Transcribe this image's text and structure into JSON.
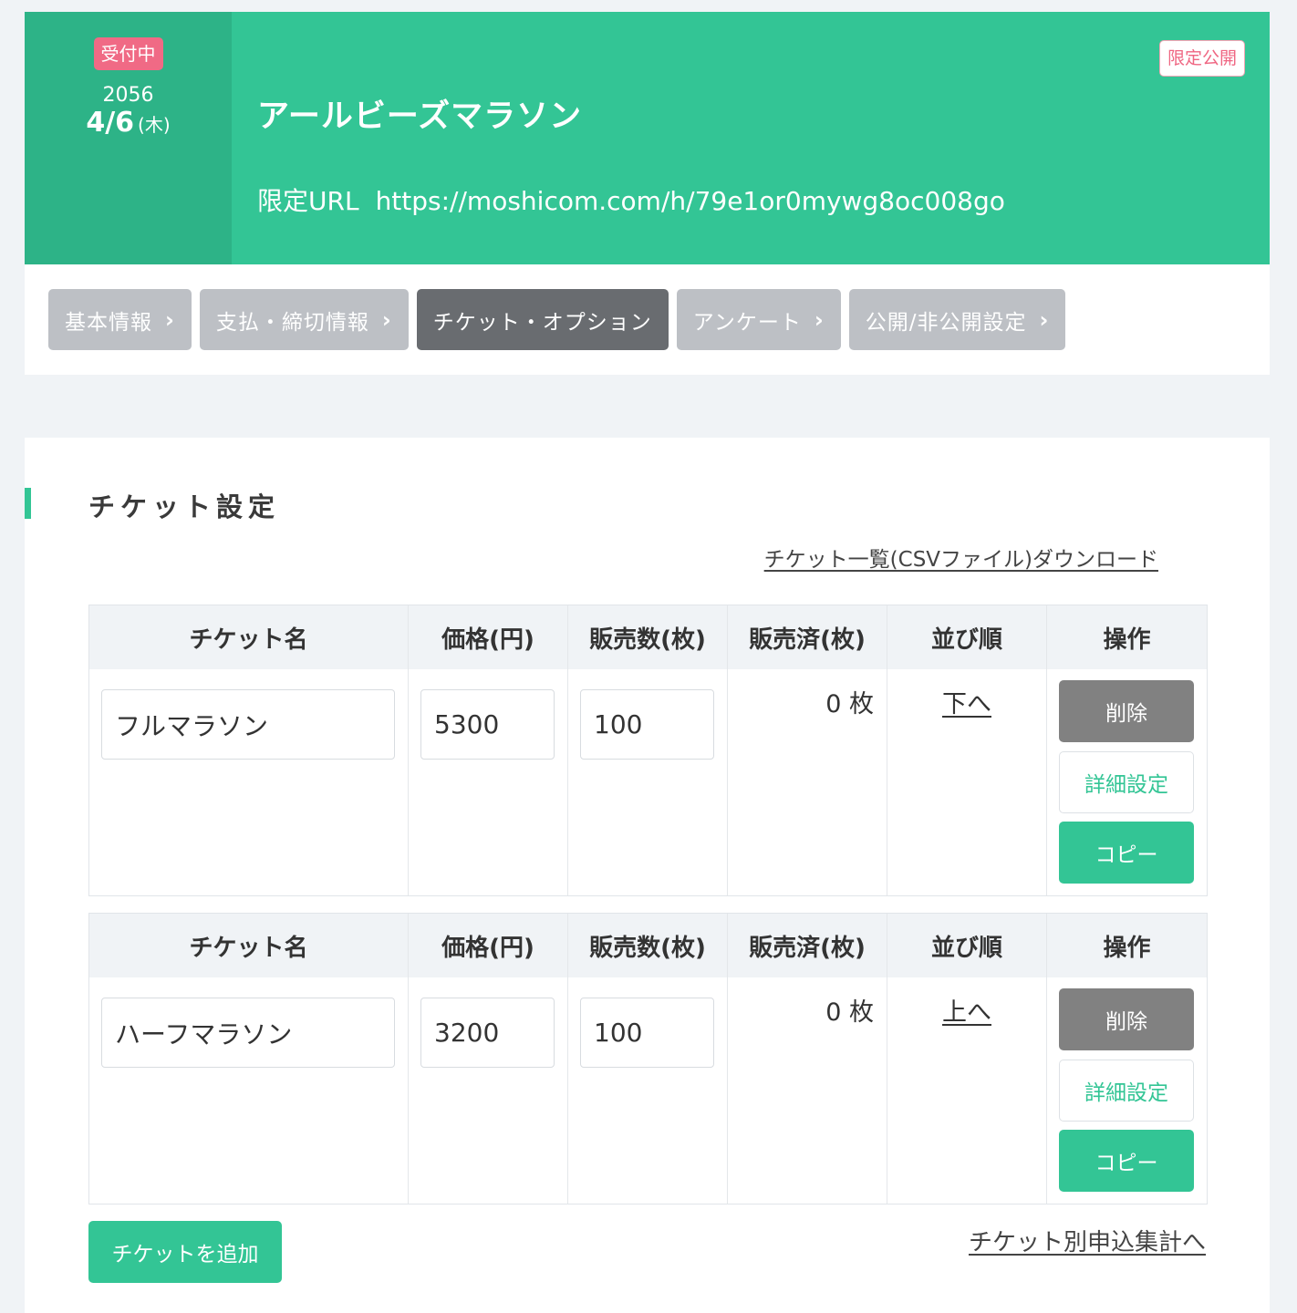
{
  "event": {
    "status": "受付中",
    "year": "2056",
    "date": "4/6",
    "weekday": "(木)",
    "title": "アールビーズマラソン",
    "url_label": "限定URL",
    "url": "https://moshicom.com/h/79e1or0mywg8oc008go",
    "visibility_badge": "限定公開"
  },
  "nav": {
    "tabs": [
      {
        "label": "基本情報",
        "active": false
      },
      {
        "label": "支払・締切情報",
        "active": false
      },
      {
        "label": "チケット・オプション",
        "active": true
      },
      {
        "label": "アンケート",
        "active": false
      },
      {
        "label": "公開/非公開設定",
        "active": false
      }
    ]
  },
  "section": {
    "title": "チケット設定",
    "csv_link": "チケット一覧(CSVファイル)ダウンロード"
  },
  "table_headers": [
    "チケット名",
    "価格(円)",
    "販売数(枚)",
    "販売済(枚)",
    "並び順",
    "操作"
  ],
  "tickets": [
    {
      "name": "フルマラソン",
      "price": "5300",
      "quantity": "100",
      "sold": "0 枚",
      "order": "下へ"
    },
    {
      "name": "ハーフマラソン",
      "price": "3200",
      "quantity": "100",
      "sold": "0 枚",
      "order": "上へ"
    }
  ],
  "actions": {
    "delete": "削除",
    "detail": "詳細設定",
    "copy": "コピー"
  },
  "footer": {
    "add_ticket": "チケットを追加",
    "aggregate_link": "チケット別申込集計へ"
  },
  "colors": {
    "accent": "#33c595",
    "status_badge": "#f06a85",
    "active_tab": "#696c70",
    "inactive_tab": "#bdc0c5"
  }
}
